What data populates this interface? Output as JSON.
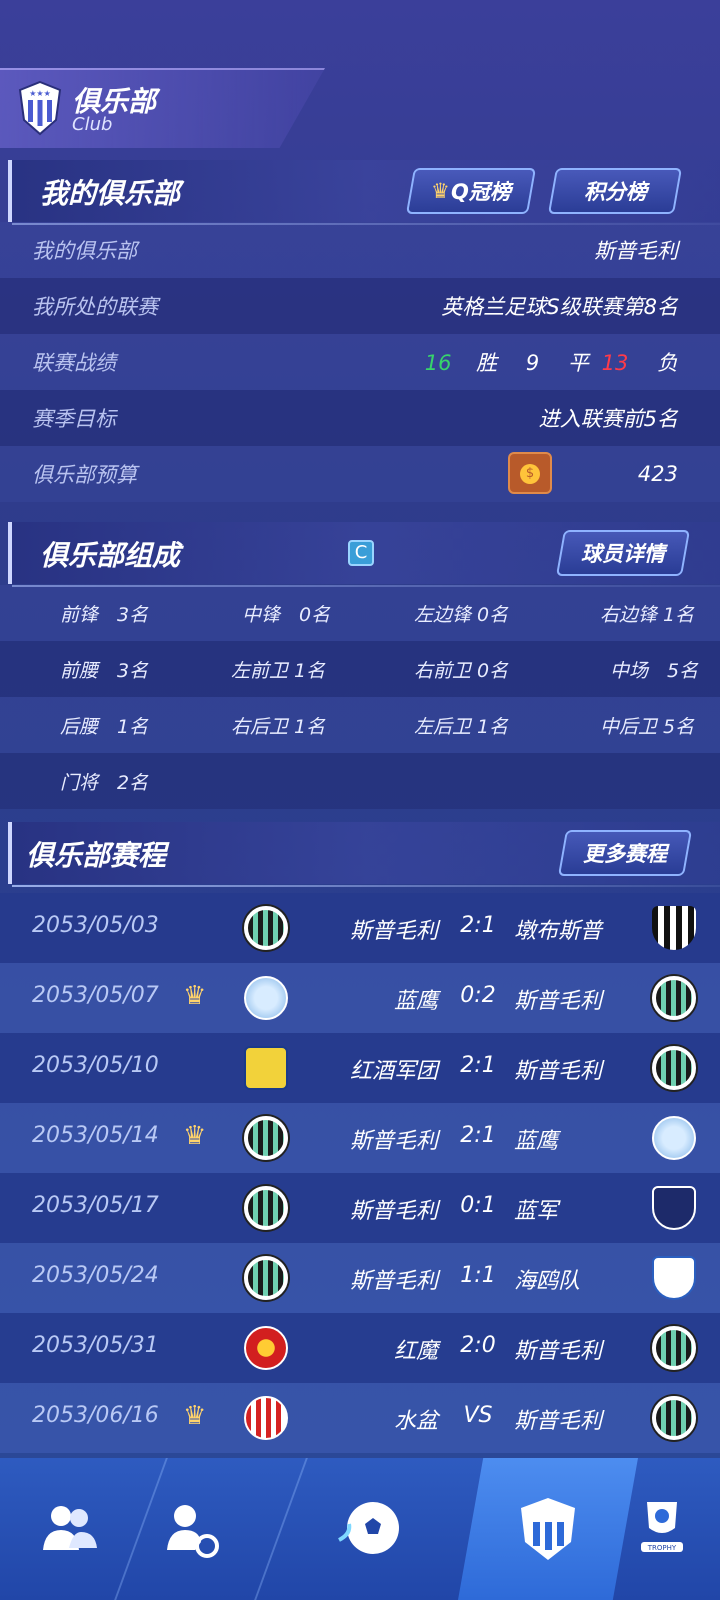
{
  "header": {
    "title": "俱乐部",
    "subtitle": "Club"
  },
  "my_club": {
    "section_title": "我的俱乐部",
    "btn_qcup": "Q冠榜",
    "btn_rank": "积分榜",
    "rows": [
      {
        "label": "我的俱乐部",
        "value": "斯普毛利"
      },
      {
        "label": "我所处的联赛",
        "value": "英格兰足球S级联赛第8名"
      },
      {
        "label": "联赛战绩"
      },
      {
        "label": "赛季目标",
        "value": "进入联赛前5名"
      },
      {
        "label": "俱乐部预算",
        "value": "423"
      }
    ],
    "record": {
      "wins": "16",
      "wins_label": "胜",
      "draws": "9",
      "draws_label": "平",
      "losses": "13",
      "losses_label": "负"
    }
  },
  "composition": {
    "section_title": "俱乐部组成",
    "grade": "C",
    "btn_details": "球员详情",
    "rows": [
      [
        "前锋　3名",
        "中锋　0名",
        "左边锋 0名",
        "右边锋 1名"
      ],
      [
        "前腰　3名",
        "左前卫 1名",
        "右前卫 0名",
        "中场　5名"
      ],
      [
        "后腰　1名",
        "右后卫 1名",
        "左后卫 1名",
        "中后卫 5名"
      ],
      [
        "门将　2名"
      ]
    ]
  },
  "fixtures": {
    "section_title": "俱乐部赛程",
    "btn_more": "更多赛程",
    "matches": [
      {
        "date": "2053/05/03",
        "crown": false,
        "home": "斯普毛利",
        "score": "2:1",
        "away": "墩布斯普",
        "home_badge": "stripe",
        "away_badge": "dark"
      },
      {
        "date": "2053/05/07",
        "crown": true,
        "home": "蓝鹰",
        "score": "0:2",
        "away": "斯普毛利",
        "home_badge": "blue",
        "away_badge": "stripe"
      },
      {
        "date": "2053/05/10",
        "crown": false,
        "home": "红酒军团",
        "score": "2:1",
        "away": "斯普毛利",
        "home_badge": "yellow",
        "away_badge": "stripe"
      },
      {
        "date": "2053/05/14",
        "crown": true,
        "home": "斯普毛利",
        "score": "2:1",
        "away": "蓝鹰",
        "home_badge": "stripe",
        "away_badge": "blue"
      },
      {
        "date": "2053/05/17",
        "crown": false,
        "home": "斯普毛利",
        "score": "0:1",
        "away": "蓝军",
        "home_badge": "stripe",
        "away_badge": "navy"
      },
      {
        "date": "2053/05/24",
        "crown": false,
        "home": "斯普毛利",
        "score": "1:1",
        "away": "海鸥队",
        "home_badge": "stripe",
        "away_badge": "white"
      },
      {
        "date": "2053/05/31",
        "crown": false,
        "home": "红魔",
        "score": "2:0",
        "away": "斯普毛利",
        "home_badge": "red",
        "away_badge": "stripe"
      },
      {
        "date": "2053/06/16",
        "crown": true,
        "home": "水盆",
        "score": "VS",
        "away": "斯普毛利",
        "home_badge": "redwhite",
        "away_badge": "stripe"
      }
    ]
  },
  "nav": {
    "items": [
      {
        "icon": "players-icon"
      },
      {
        "icon": "transfer-icon"
      },
      {
        "icon": "football-icon"
      },
      {
        "icon": "club-icon",
        "active": true
      },
      {
        "icon": "trophy-icon",
        "label": "TROPHY"
      }
    ]
  },
  "colors": {
    "win": "#37d46b",
    "loss": "#ff3b4a",
    "accent": "#8fb3ff"
  }
}
